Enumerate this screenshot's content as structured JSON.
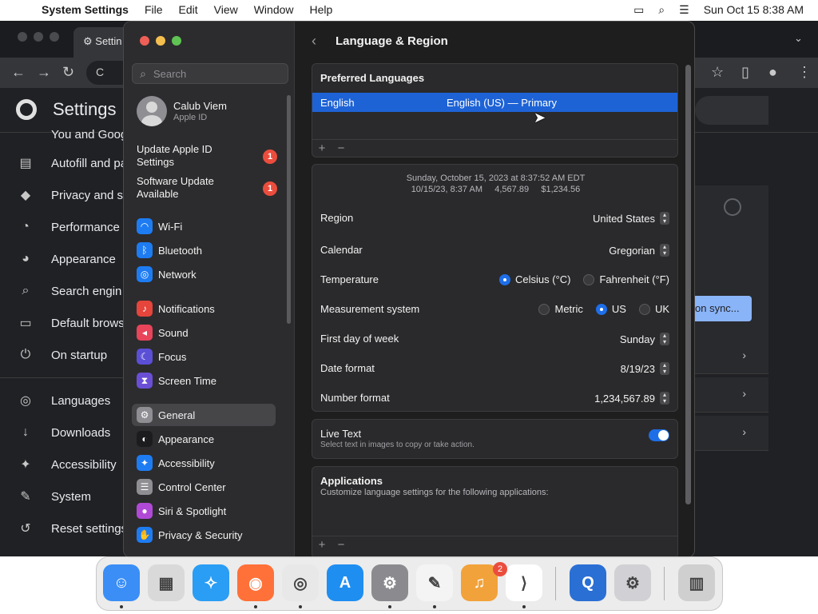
{
  "menubar": {
    "app_name": "System Settings",
    "items": [
      "File",
      "Edit",
      "View",
      "Window",
      "Help"
    ],
    "datetime": "Sun Oct 15  8:38 AM"
  },
  "chrome": {
    "tab_title": "Settin",
    "omnibox_text": "C",
    "page_title": "Settings",
    "partial_item": "You and Goog",
    "nav": [
      {
        "label": "Autofill and pa",
        "icon": "clipboard-icon"
      },
      {
        "label": "Privacy and s",
        "icon": "shield-icon"
      },
      {
        "label": "Performance",
        "icon": "speedometer-icon"
      },
      {
        "label": "Appearance",
        "icon": "palette-icon"
      },
      {
        "label": "Search engin",
        "icon": "search-icon"
      },
      {
        "label": "Default brows",
        "icon": "browser-icon"
      },
      {
        "label": "On startup",
        "icon": "power-icon"
      },
      {
        "label": "Languages",
        "icon": "globe-icon"
      },
      {
        "label": "Downloads",
        "icon": "download-icon"
      },
      {
        "label": "Accessibility",
        "icon": "accessibility-icon"
      },
      {
        "label": "System",
        "icon": "wrench-icon"
      },
      {
        "label": "Reset settings",
        "icon": "reset-icon"
      }
    ],
    "sync_button": "on sync..."
  },
  "sidebar": {
    "search_placeholder": "Search",
    "user_name": "Calub Viem",
    "user_sub": "Apple ID",
    "alerts": [
      {
        "label": "Update Apple ID Settings",
        "count": "1"
      },
      {
        "label": "Software Update Available",
        "count": "1"
      }
    ],
    "groups": [
      [
        {
          "label": "Wi-Fi",
          "color": "#1e7cf2",
          "icon": "wifi-icon"
        },
        {
          "label": "Bluetooth",
          "color": "#1e7cf2",
          "icon": "bluetooth-icon"
        },
        {
          "label": "Network",
          "color": "#1e7cf2",
          "icon": "globe-icon"
        }
      ],
      [
        {
          "label": "Notifications",
          "color": "#e5453b",
          "icon": "bell-icon"
        },
        {
          "label": "Sound",
          "color": "#e8445a",
          "icon": "speaker-icon"
        },
        {
          "label": "Focus",
          "color": "#5b4fd6",
          "icon": "moon-icon"
        },
        {
          "label": "Screen Time",
          "color": "#6a4fd6",
          "icon": "hourglass-icon"
        }
      ],
      [
        {
          "label": "General",
          "color": "#8e8e93",
          "icon": "gear-icon"
        },
        {
          "label": "Appearance",
          "color": "#1c1c1e",
          "icon": "appearance-icon"
        },
        {
          "label": "Accessibility",
          "color": "#1e7cf2",
          "icon": "accessibility-icon"
        },
        {
          "label": "Control Center",
          "color": "#8e8e93",
          "icon": "control-center-icon"
        },
        {
          "label": "Siri & Spotlight",
          "color": "#b04ad6",
          "icon": "siri-icon"
        },
        {
          "label": "Privacy & Security",
          "color": "#1e7cf2",
          "icon": "hand-icon"
        }
      ]
    ]
  },
  "main": {
    "title": "Language & Region",
    "preferred_languages": {
      "heading": "Preferred Languages",
      "language": "English",
      "detail": "English (US) — Primary"
    },
    "preview": {
      "line1": "Sunday, October 15, 2023 at 8:37:52 AM EDT",
      "line2": "10/15/23, 8:37 AM     4,567.89     $1,234.56"
    },
    "region": {
      "label": "Region",
      "value": "United States"
    },
    "calendar": {
      "label": "Calendar",
      "value": "Gregorian"
    },
    "temperature": {
      "label": "Temperature",
      "options": [
        "Celsius (°C)",
        "Fahrenheit (°F)"
      ],
      "selected": "Celsius (°C)"
    },
    "measurement": {
      "label": "Measurement system",
      "options": [
        "Metric",
        "US",
        "UK"
      ],
      "selected": "US"
    },
    "first_day": {
      "label": "First day of week",
      "value": "Sunday"
    },
    "date_format": {
      "label": "Date format",
      "value": "8/19/23"
    },
    "number_format": {
      "label": "Number format",
      "value": "1,234,567.89"
    },
    "live_text": {
      "title": "Live Text",
      "subtitle": "Select text in images to copy or take action.",
      "enabled": true
    },
    "applications": {
      "title": "Applications",
      "subtitle": "Customize language settings for the following applications:"
    }
  },
  "dock": {
    "settings_badge": "2",
    "apps": [
      {
        "name": "Finder",
        "icon": "finder-icon"
      },
      {
        "name": "Launchpad",
        "icon": "launchpad-icon"
      },
      {
        "name": "Safari",
        "icon": "safari-icon"
      },
      {
        "name": "Firefox",
        "icon": "firefox-icon"
      },
      {
        "name": "Chrome",
        "icon": "chrome-icon"
      },
      {
        "name": "App Store",
        "icon": "app-store-icon"
      },
      {
        "name": "System Settings",
        "icon": "system-settings-icon"
      },
      {
        "name": "TextEdit",
        "icon": "textedit-icon"
      },
      {
        "name": "GarageBand",
        "icon": "garageband-icon"
      },
      {
        "name": "VS Code",
        "icon": "vscode-icon"
      },
      {
        "name": "QuickTime",
        "icon": "quicktime-icon"
      },
      {
        "name": "Settings Helper",
        "icon": "gear-icon"
      },
      {
        "name": "Trash",
        "icon": "trash-icon"
      }
    ]
  }
}
